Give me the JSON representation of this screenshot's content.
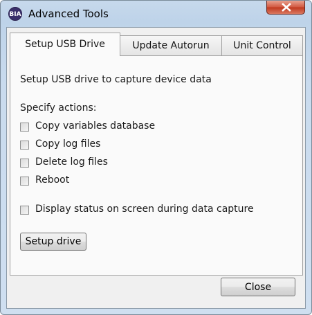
{
  "window": {
    "title": "Advanced Tools",
    "app_icon_text": "BIA",
    "close_icon": "close-icon"
  },
  "tabs": [
    {
      "label": "Setup USB Drive",
      "active": true
    },
    {
      "label": "Update Autorun",
      "active": false
    },
    {
      "label": "Unit Control",
      "active": false
    }
  ],
  "panel": {
    "description": "Setup USB drive to capture device data",
    "actions_label": "Specify actions:",
    "actions": [
      {
        "label": "Copy variables database",
        "checked": false
      },
      {
        "label": "Copy log files",
        "checked": false
      },
      {
        "label": "Delete log files",
        "checked": false
      },
      {
        "label": "Reboot",
        "checked": false
      }
    ],
    "display_status": {
      "label": "Display status on screen during data capture",
      "checked": false
    },
    "setup_button": "Setup drive"
  },
  "footer": {
    "close_button": "Close"
  }
}
